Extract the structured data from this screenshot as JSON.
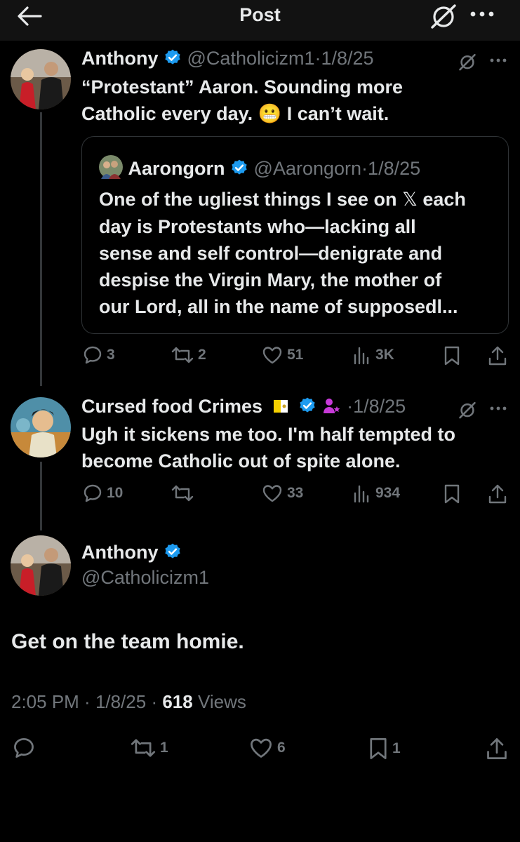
{
  "header": {
    "title": "Post"
  },
  "tweet1": {
    "name": "Anthony",
    "handle": "@Catholicizm1",
    "date": "1/8/25",
    "line1": "“Protestant” Aaron. Sounding more",
    "line2a": "Catholic every day.",
    "emoji": "😬",
    "line2b": "I can’t wait.",
    "quote": {
      "name": "Aarongorn",
      "handle": "@Aarongorn",
      "date": "1/8/25",
      "line1a": "One of the ugliest things I see on",
      "x_glyph": "𝕏",
      "line1b": "each",
      "line2": "day is Protestants who—lacking all",
      "line3": "sense and self control—denigrate and",
      "line4": "despise the Virgin Mary, the mother of",
      "line5": "our Lord, all in the name of supposedl..."
    },
    "stats": {
      "replies": "3",
      "reposts": "2",
      "likes": "51",
      "views": "3K"
    }
  },
  "tweet2": {
    "name": "Cursed food Crimes",
    "date": "1/8/25",
    "line1": "Ugh it sickens me too. I'm half tempted to",
    "line2": "become Catholic out of spite alone.",
    "stats": {
      "replies": "10",
      "reposts": "",
      "likes": "33",
      "views": "934"
    }
  },
  "main": {
    "name": "Anthony",
    "handle": "@Catholicizm1",
    "text": "Get on the team homie.",
    "time": "2:05 PM",
    "date": "1/8/25",
    "views_count": "618",
    "views_label": "Views",
    "stats": {
      "reposts": "1",
      "likes": "6",
      "bookmarks": "1"
    }
  },
  "colors": {
    "accent": "#1d9bf0",
    "muted": "#71767b",
    "bg": "#000000",
    "text": "#e7e9ea",
    "border": "#2f3336"
  },
  "icons": [
    "back-arrow-icon",
    "grok-icon",
    "more-icon",
    "verified-icon",
    "reply-icon",
    "repost-icon",
    "like-icon",
    "views-icon",
    "bookmark-icon",
    "share-icon",
    "vatican-flag-icon",
    "affiliate-badge-icon"
  ]
}
